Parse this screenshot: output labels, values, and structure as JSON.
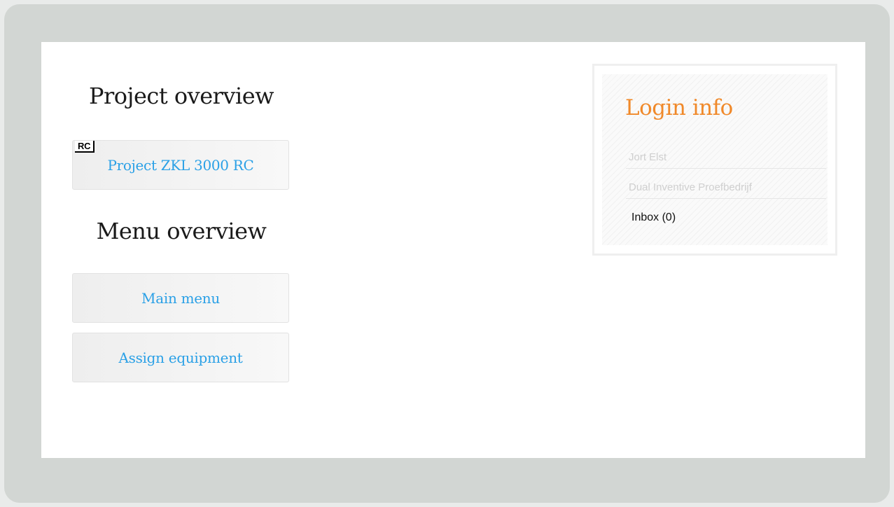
{
  "project_overview": {
    "title": "Project overview",
    "projects": [
      {
        "badge": "RC",
        "label": "Project ZKL 3000 RC"
      }
    ]
  },
  "menu_overview": {
    "title": "Menu overview",
    "items": [
      {
        "label": "Main menu"
      },
      {
        "label": "Assign equipment"
      }
    ]
  },
  "login_info": {
    "title": "Login info",
    "user": "Jort Elst",
    "company": "Dual Inventive Proefbedrijf",
    "inbox_label": "Inbox (0)"
  },
  "colors": {
    "accent_blue": "#2aa0e6",
    "accent_orange": "#f0892a",
    "frame_gray": "#d2d6d3"
  }
}
